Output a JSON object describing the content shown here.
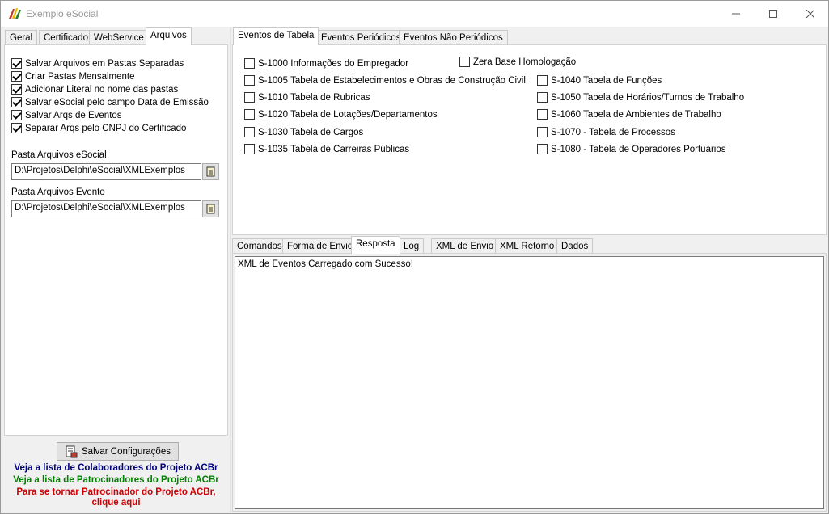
{
  "window": {
    "title": "Exemplo eSocial"
  },
  "left_tabs": [
    "Geral",
    "Certificado",
    "WebService",
    "Arquivos"
  ],
  "left_active": "Arquivos",
  "options": [
    {
      "label": "Salvar Arquivos em Pastas Separadas",
      "checked": true
    },
    {
      "label": "Criar Pastas Mensalmente",
      "checked": true
    },
    {
      "label": "Adicionar Literal no nome das pastas",
      "checked": true
    },
    {
      "label": "Salvar eSocial pelo campo Data de Emissão",
      "checked": true
    },
    {
      "label": "Salvar Arqs de Eventos",
      "checked": true
    },
    {
      "label": "Separar Arqs pelo CNPJ do Certificado",
      "checked": true
    }
  ],
  "pasta_esocial": {
    "label": "Pasta Arquivos eSocial",
    "value": "D:\\Projetos\\Delphi\\eSocial\\XMLExemplos"
  },
  "pasta_evento": {
    "label": "Pasta Arquivos Evento",
    "value": "D:\\Projetos\\Delphi\\eSocial\\XMLExemplos"
  },
  "save_button": "Salvar Configurações",
  "links": {
    "colaboradores": "Veja a lista de Colaboradores do Projeto ACBr",
    "patrocinadores": "Veja a lista de Patrocinadores do Projeto ACBr",
    "patrocinador_1": "Para se tornar Patrocinador do Projeto ACBr,",
    "patrocinador_2": "clique aqui"
  },
  "event_tabs": [
    "Eventos de Tabela",
    "Eventos Periódicos",
    "Eventos Não Periódicos"
  ],
  "event_active": "Eventos de Tabela",
  "zera_base": "Zera Base Homologação",
  "events_left": [
    "S-1000 Informações do Empregador",
    "S-1005 Tabela de Estabelecimentos e Obras de Construção Civil",
    "S-1010 Tabela de Rubricas",
    "S-1020 Tabela de Lotações/Departamentos",
    "S-1030 Tabela de Cargos",
    "S-1035 Tabela de Carreiras Públicas"
  ],
  "events_right": [
    "S-1040 Tabela de Funções",
    "S-1050 Tabela de Horários/Turnos de Trabalho",
    "S-1060 Tabela de Ambientes de Trabalho",
    "S-1070 - Tabela de Processos",
    "S-1080 - Tabela de Operadores Portuários"
  ],
  "bottom_tabs": [
    "Comandos",
    "Forma de Envio",
    "Resposta",
    "Log",
    "XML de Envio",
    "XML Retorno",
    "Dados"
  ],
  "bottom_active": "Resposta",
  "response_text": "XML de Eventos Carregado com Sucesso!",
  "colors": {
    "link_blue": "#000080",
    "link_green": "#008000",
    "link_red": "#cc0000"
  }
}
